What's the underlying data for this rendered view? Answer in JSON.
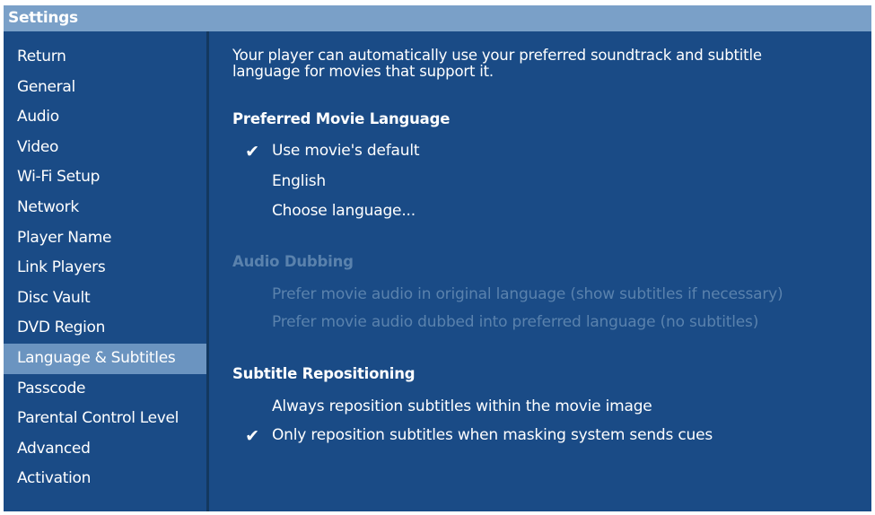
{
  "window": {
    "title": "Settings"
  },
  "sidebar": {
    "items": [
      {
        "label": "Return"
      },
      {
        "label": "General"
      },
      {
        "label": "Audio"
      },
      {
        "label": "Video"
      },
      {
        "label": "Wi-Fi Setup"
      },
      {
        "label": "Network"
      },
      {
        "label": "Player Name"
      },
      {
        "label": "Link Players"
      },
      {
        "label": "Disc Vault"
      },
      {
        "label": "DVD Region"
      },
      {
        "label": "Language & Subtitles",
        "selected": true
      },
      {
        "label": "Passcode"
      },
      {
        "label": "Parental Control Level"
      },
      {
        "label": "Advanced"
      },
      {
        "label": "Activation"
      }
    ]
  },
  "main": {
    "intro_line1": "Your player can automatically use your preferred soundtrack and subtitle",
    "intro_line2": "language for movies that support it.",
    "preferred_language": {
      "title": "Preferred Movie Language",
      "options": [
        {
          "label": "Use movie's default",
          "checked": true
        },
        {
          "label": "English",
          "checked": false
        },
        {
          "label": "Choose language...",
          "checked": false
        }
      ]
    },
    "audio_dubbing": {
      "title": "Audio Dubbing",
      "disabled": true,
      "options": [
        {
          "label": "Prefer movie audio in original language (show subtitles if necessary)"
        },
        {
          "label": "Prefer movie audio dubbed into preferred language (no subtitles)"
        }
      ]
    },
    "subtitle_repositioning": {
      "title": "Subtitle Repositioning",
      "options": [
        {
          "label": "Always reposition subtitles within the movie image",
          "checked": false
        },
        {
          "label": "Only reposition subtitles when masking system sends cues",
          "checked": true
        }
      ]
    },
    "check_glyph": "✔"
  },
  "colors": {
    "background": "#1a4b86",
    "titlebar": "#7aa0c8",
    "selected_item": "#6b94c0",
    "disabled_text": "#5a82ad"
  }
}
